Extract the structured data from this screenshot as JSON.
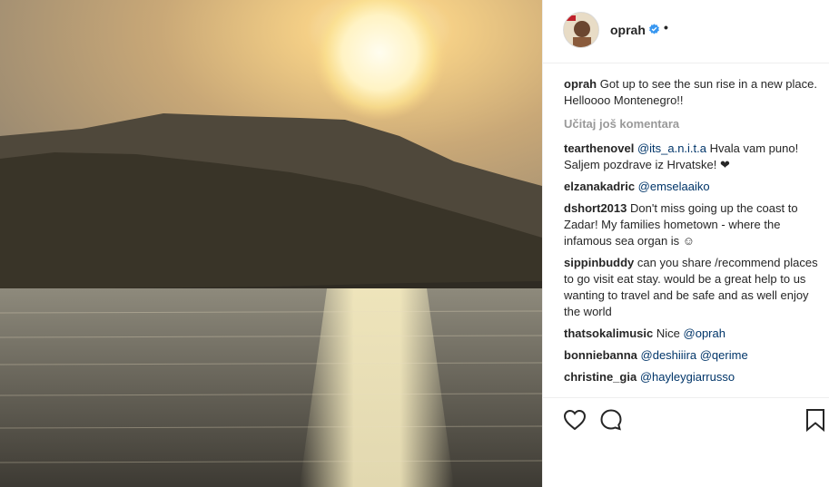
{
  "post": {
    "username": "oprah",
    "dot": "•",
    "caption_user": "oprah",
    "caption_line1": "Got up to see the sun rise in a new place.",
    "caption_line2": "Helloooo Montenegro!!",
    "load_more": "Učitaj još komentara"
  },
  "comments": [
    {
      "user": "tearthenovel",
      "mention": "@its_a.n.i.t.a",
      "text": " Hvala vam puno! Saljem pozdrave iz Hrvatske! ❤"
    },
    {
      "user": "elzanakadric",
      "mention": "@emselaaiko",
      "text": ""
    },
    {
      "user": "dshort2013",
      "mention": "",
      "text": "Don't miss going up the coast to Zadar! My families hometown - where the infamous sea organ is ☺"
    },
    {
      "user": "sippinbuddy",
      "mention": "",
      "text": "can you share /recommend places to go visit eat stay. would be a great help to us wanting to travel and be safe and as well enjoy the world"
    },
    {
      "user": "thatsokalimusic",
      "mention": "",
      "text": "Nice ",
      "mention_after": "@oprah"
    },
    {
      "user": "bonniebanna",
      "mention": "@deshiiira @qerime",
      "text": ""
    },
    {
      "user": "christine_gia",
      "mention": "@hayleygiarrusso",
      "text": ""
    }
  ],
  "icons": {
    "like": "heart-icon",
    "comment": "comment-icon",
    "save": "bookmark-icon",
    "verified": "verified-badge-icon"
  },
  "colors": {
    "mention": "#003569",
    "verified": "#3897f0",
    "muted": "#999999"
  }
}
